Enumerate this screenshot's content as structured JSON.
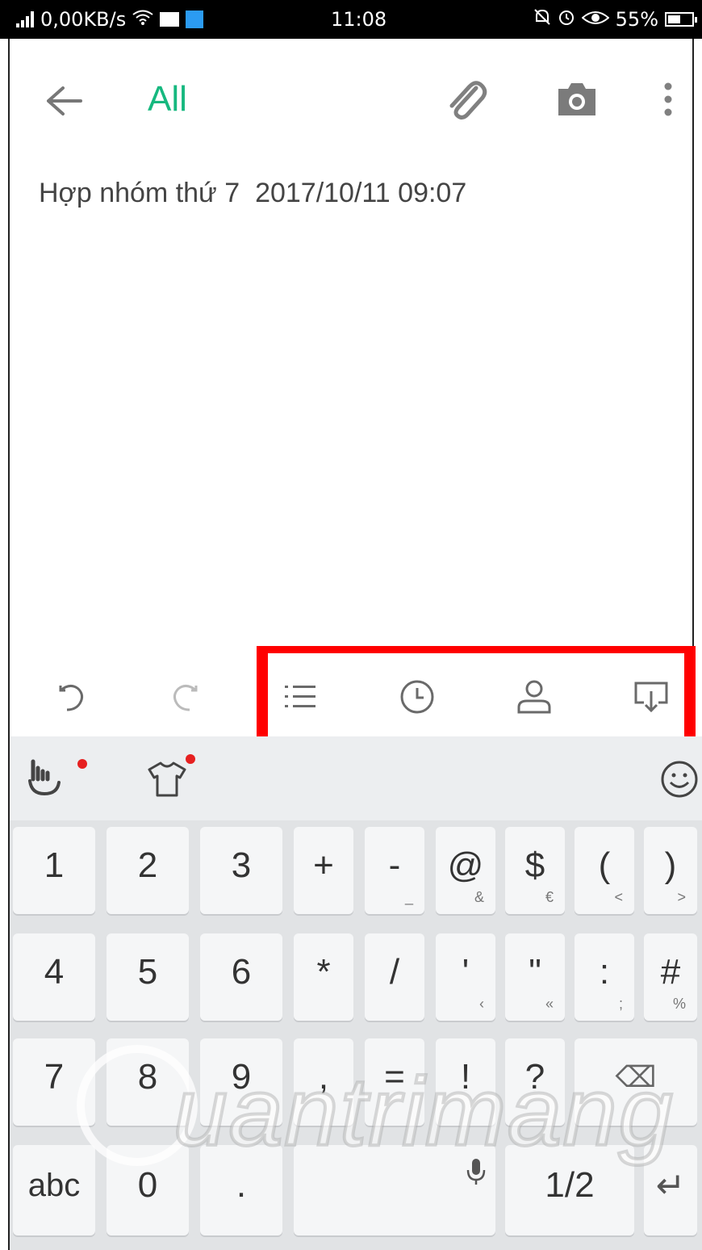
{
  "status_bar": {
    "network_speed": "0,00KB/s",
    "time": "11:08",
    "battery": "55%",
    "battery_level": 0.55
  },
  "toolbar": {
    "title": "All",
    "title_color": "#16b87f",
    "back_icon": "back-arrow-icon",
    "attach_icon": "paperclip-icon",
    "camera_icon": "camera-icon",
    "more_icon": "more-vert-icon"
  },
  "note": {
    "text": "Hợp nhóm thứ 7  2017/10/11 09:07"
  },
  "edit_tools": {
    "items": [
      "undo-icon",
      "redo-icon",
      "checklist-icon",
      "clock-icon",
      "person-icon",
      "save-icon"
    ],
    "highlight_color": "#ff0000"
  },
  "keyboard": {
    "top_icons": [
      "swype-hand-icon",
      "shirt-theme-icon",
      "emoji-icon"
    ],
    "rows": [
      [
        {
          "main": "1",
          "sub": ""
        },
        {
          "main": "2",
          "sub": ""
        },
        {
          "main": "3",
          "sub": ""
        },
        {
          "main": "+",
          "sub": ""
        },
        {
          "main": "-",
          "sub": "_"
        },
        {
          "main": "@",
          "sub": "&"
        },
        {
          "main": "$",
          "sub": "€"
        },
        {
          "main": "(",
          "sub": "<"
        },
        {
          "main": ")",
          "sub": ">"
        }
      ],
      [
        {
          "main": "4",
          "sub": ""
        },
        {
          "main": "5",
          "sub": ""
        },
        {
          "main": "6",
          "sub": ""
        },
        {
          "main": "*",
          "sub": ""
        },
        {
          "main": "/",
          "sub": ""
        },
        {
          "main": "'",
          "sub": "‹"
        },
        {
          "main": "\"",
          "sub": "«"
        },
        {
          "main": ":",
          "sub": ";"
        },
        {
          "main": "#",
          "sub": "%"
        }
      ],
      [
        {
          "main": "7",
          "sub": ""
        },
        {
          "main": "8",
          "sub": ""
        },
        {
          "main": "9",
          "sub": ""
        },
        {
          "main": ",",
          "sub": ""
        },
        {
          "main": "=",
          "sub": ""
        },
        {
          "main": "!",
          "sub": ""
        },
        {
          "main": "?",
          "sub": ""
        },
        {
          "main": "⌫",
          "sub": ""
        }
      ],
      [
        {
          "main": "abc",
          "sub": ""
        },
        {
          "main": "0",
          "sub": ""
        },
        {
          "main": ".",
          "sub": ""
        },
        {
          "main": "",
          "sub": ""
        },
        {
          "main": "1/2",
          "sub": ""
        },
        {
          "main": "↵",
          "sub": ""
        }
      ]
    ]
  },
  "watermark": {
    "text": "uantrimang"
  }
}
